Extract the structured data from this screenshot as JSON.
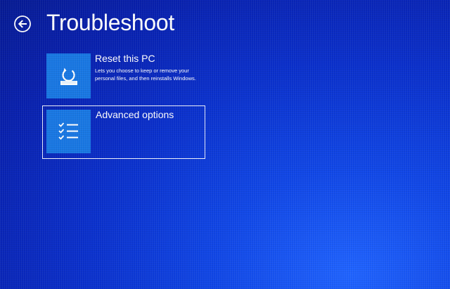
{
  "header": {
    "title": "Troubleshoot",
    "back_icon": "back-arrow-circle-icon"
  },
  "options": [
    {
      "title": "Reset this PC",
      "description": "Lets you choose to keep or remove your personal files, and then reinstalls Windows.",
      "icon": "reset-pc-icon",
      "selected": false
    },
    {
      "title": "Advanced options",
      "description": "",
      "icon": "checklist-icon",
      "selected": true
    }
  ],
  "colors": {
    "background": "#0a2fcb",
    "tile_icon_bg": "#1877e3",
    "text": "#ffffff"
  }
}
